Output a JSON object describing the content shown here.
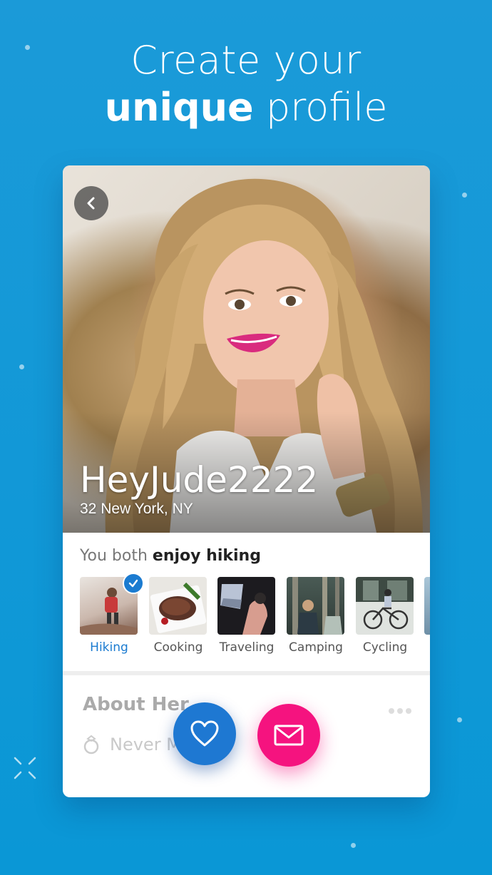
{
  "headline": {
    "line1": "Create your",
    "line2_bold": "unique",
    "line2_rest": "profile"
  },
  "profile": {
    "username": "HeyJude2222",
    "location": "32 New York, NY"
  },
  "match": {
    "prefix": "You both",
    "activity": "enjoy hiking"
  },
  "interests": [
    {
      "label": "Hiking",
      "selected": true
    },
    {
      "label": "Cooking",
      "selected": false
    },
    {
      "label": "Traveling",
      "selected": false
    },
    {
      "label": "Camping",
      "selected": false
    },
    {
      "label": "Cycling",
      "selected": false
    }
  ],
  "about": {
    "title": "About Her",
    "status": "Never M"
  },
  "colors": {
    "background": "#0a97d6",
    "accent_blue": "#1e78d2",
    "accent_pink": "#f5137f"
  },
  "icons": {
    "back": "chevron-left-icon",
    "like": "heart-icon",
    "message": "envelope-icon",
    "ring": "ring-icon",
    "check": "check-icon"
  }
}
